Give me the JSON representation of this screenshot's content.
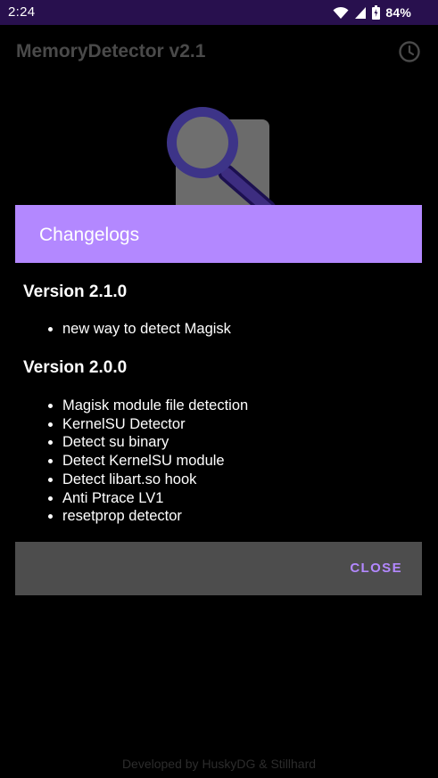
{
  "status_bar": {
    "time": "2:24",
    "battery": "84%",
    "icons": [
      "wifi-icon",
      "signal-icon",
      "battery-icon"
    ]
  },
  "app_bar": {
    "title": "MemoryDetector v2.1",
    "action_icon": "history-icon"
  },
  "logo_icon": "magnifier-document-icon",
  "footer": {
    "credit": "Developed by HuskyDG & Stillhard"
  },
  "dialog": {
    "title": "Changelogs",
    "versions": [
      {
        "heading": "Version 2.1.0",
        "items": [
          "new way to detect Magisk"
        ]
      },
      {
        "heading": "Version 2.0.0",
        "items": [
          "Magisk module file detection",
          "KernelSU Detector",
          "Detect su binary",
          "Detect KernelSU module",
          "Detect libart.so hook",
          "Anti Ptrace LV1",
          "resetprop detector"
        ]
      }
    ],
    "close_label": "CLOSE"
  },
  "colors": {
    "accent": "#b388ff",
    "status_bar": "#28104e",
    "dialog_footer": "#4d4d4d",
    "background": "#000000"
  }
}
